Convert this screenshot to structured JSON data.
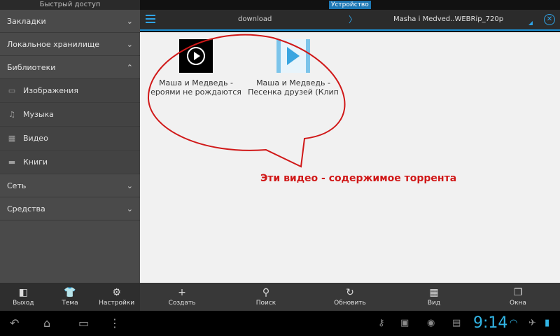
{
  "sidebar": {
    "title": "Быстрый доступ",
    "sections": [
      {
        "label": "Закладки",
        "expanded": false
      },
      {
        "label": "Локальное хранилище",
        "expanded": false
      },
      {
        "label": "Библиотеки",
        "expanded": true
      },
      {
        "label": "Сеть",
        "expanded": false
      },
      {
        "label": "Средства",
        "expanded": false
      }
    ],
    "library_items": [
      {
        "label": "Изображения",
        "icon": "image-icon"
      },
      {
        "label": "Музыка",
        "icon": "music-icon"
      },
      {
        "label": "Видео",
        "icon": "video-icon"
      },
      {
        "label": "Книги",
        "icon": "book-icon"
      }
    ]
  },
  "topbar": {
    "device_label": "Устройство"
  },
  "pathbar": {
    "segment1": "download",
    "separator": "〉",
    "segment2": "Masha i Medved..WEBRip_720p"
  },
  "files": [
    {
      "line1": "Маша и Медведь -",
      "line2": "ероями не рождаются",
      "icon": "video-play-icon"
    },
    {
      "line1": "Маша и Медведь -",
      "line2": "Песенка друзей (Клип",
      "icon": "video-file-icon"
    }
  ],
  "annotation": {
    "text": "Эти видео - содержимое торрента",
    "color": "#d01818"
  },
  "toolbar_left": [
    {
      "label": "Выход",
      "icon": "exit-icon"
    },
    {
      "label": "Тема",
      "icon": "theme-icon"
    },
    {
      "label": "Настройки",
      "icon": "settings-icon"
    }
  ],
  "toolbar_main": [
    {
      "label": "Создать",
      "icon": "plus-icon"
    },
    {
      "label": "Поиск",
      "icon": "search-icon"
    },
    {
      "label": "Обновить",
      "icon": "refresh-icon"
    },
    {
      "label": "Вид",
      "icon": "grid-icon"
    },
    {
      "label": "Окна",
      "icon": "windows-icon"
    }
  ],
  "statusbar": {
    "time": "9:14"
  },
  "colors": {
    "accent": "#2fa3e6",
    "sidebar_bg": "#4a4a4a",
    "content_bg": "#f1f1f1",
    "clock": "#32b5e5"
  }
}
